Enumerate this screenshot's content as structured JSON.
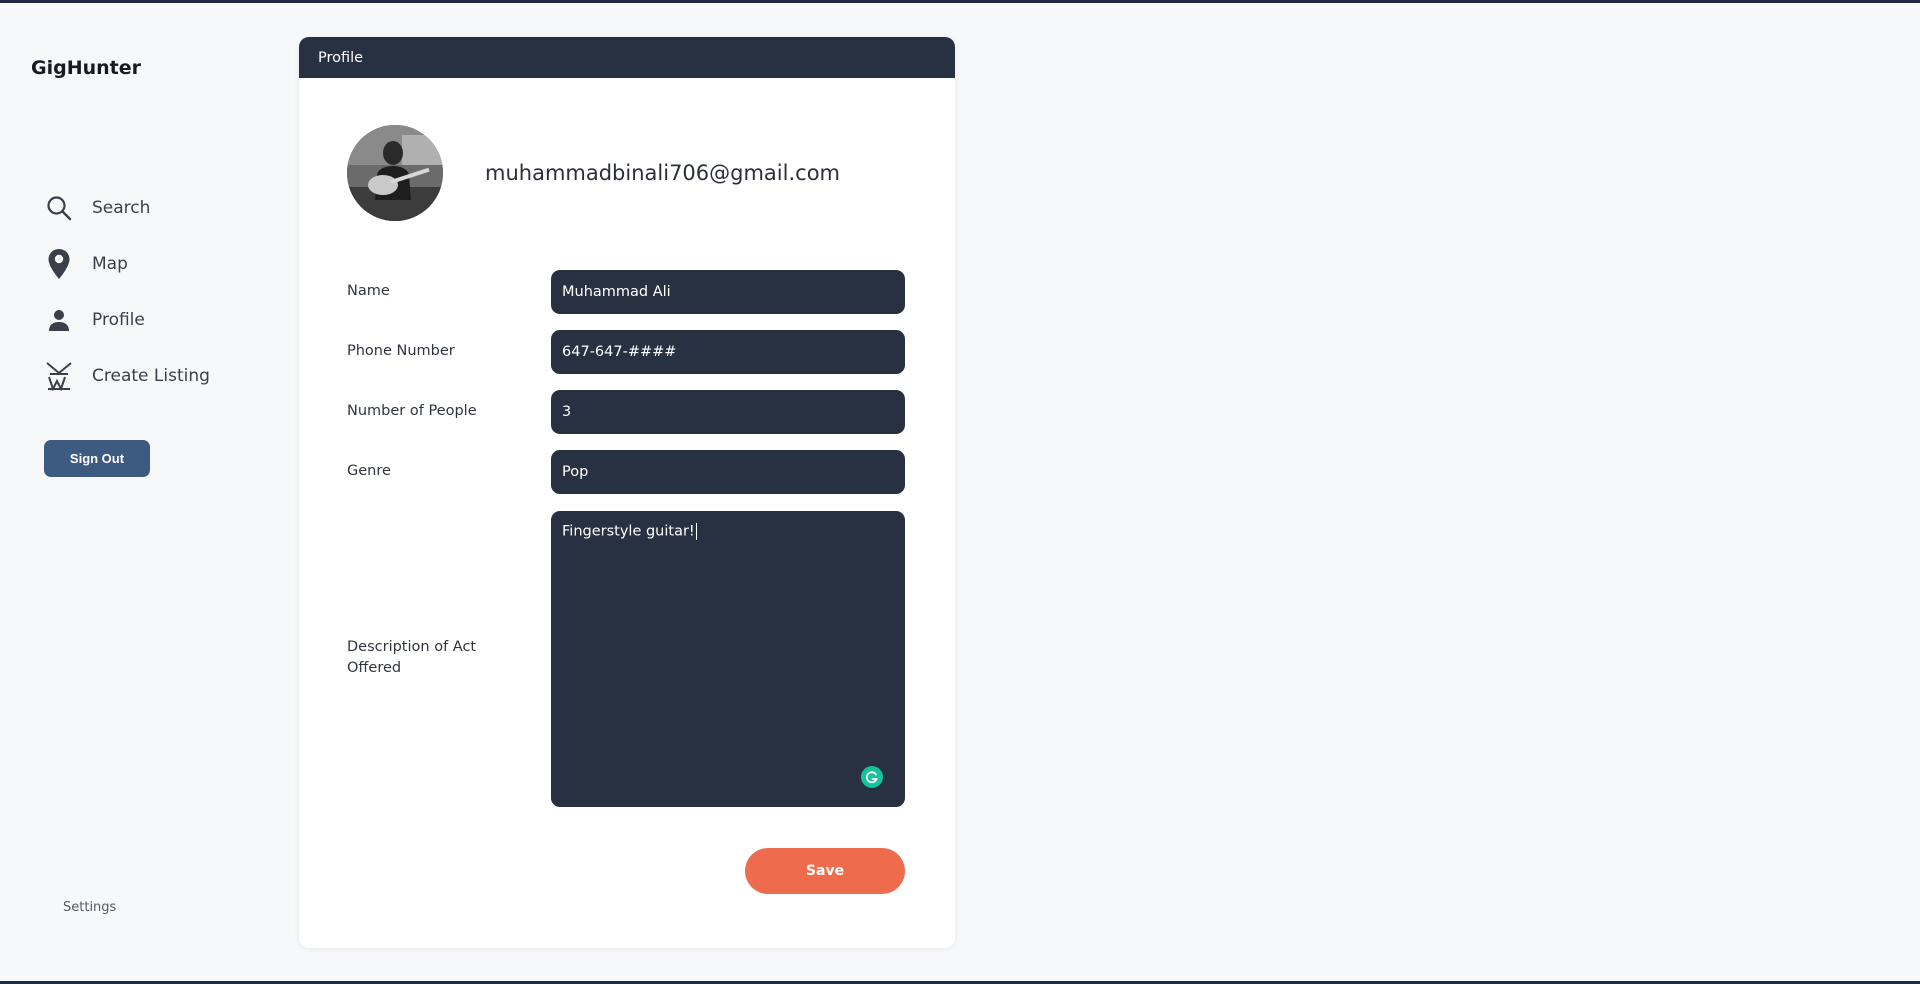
{
  "app": {
    "brand": "GigHunter"
  },
  "sidebar": {
    "items": [
      {
        "label": "Search",
        "icon": "search-icon"
      },
      {
        "label": "Map",
        "icon": "map-pin-icon"
      },
      {
        "label": "Profile",
        "icon": "person-icon"
      },
      {
        "label": "Create Listing",
        "icon": "create-listing-icon"
      }
    ],
    "sign_out_label": "Sign Out",
    "settings_label": "Settings"
  },
  "profile": {
    "header_title": "Profile",
    "email": "muhammadbinali706@gmail.com",
    "fields": {
      "name": {
        "label": "Name",
        "value": "Muhammad Ali"
      },
      "phone": {
        "label": "Phone Number",
        "value": "647-647-####"
      },
      "people": {
        "label": "Number of People",
        "value": "3"
      },
      "genre": {
        "label": "Genre",
        "value": "Pop"
      },
      "description": {
        "label": "Description of Act Offered",
        "value": "Fingerstyle guitar!"
      }
    },
    "save_label": "Save"
  },
  "colors": {
    "accent": "#ee6c4d",
    "sidebar_button": "#3d5a80",
    "dark_field": "#283141",
    "grammarly": "#15c39a"
  }
}
